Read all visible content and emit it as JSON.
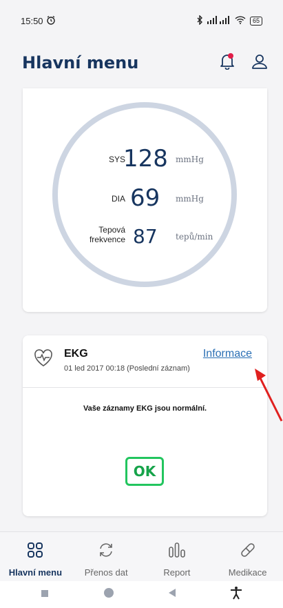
{
  "status": {
    "time": "15:50",
    "battery": "65"
  },
  "header": {
    "title": "Hlavní menu"
  },
  "bp": {
    "sys_label": "SYS",
    "sys_value": "128",
    "sys_unit": "mmHg",
    "dia_label": "DIA",
    "dia_value": "69",
    "dia_unit": "mmHg",
    "pulse_label_1": "Tepová",
    "pulse_label_2": "frekvence",
    "pulse_value": "87",
    "pulse_unit": "tepů/min"
  },
  "ekg": {
    "title": "EKG",
    "subtitle": "01 led 2017 00:18 (Poslední záznam)",
    "link": "Informace",
    "message": "Vaše záznamy EKG jsou normální.",
    "ok": "OK"
  },
  "nav": {
    "items": [
      {
        "label": "Hlavní menu",
        "icon": "grid-icon",
        "active": true
      },
      {
        "label": "Přenos dat",
        "icon": "sync-icon",
        "active": false
      },
      {
        "label": "Report",
        "icon": "report-icon",
        "active": false
      },
      {
        "label": "Medikace",
        "icon": "pill-icon",
        "active": false
      }
    ]
  },
  "colors": {
    "brand": "#17355f",
    "link": "#2a6fb4",
    "ok": "#22c55e",
    "alert": "#e11d48",
    "arrow": "#e0201f"
  }
}
